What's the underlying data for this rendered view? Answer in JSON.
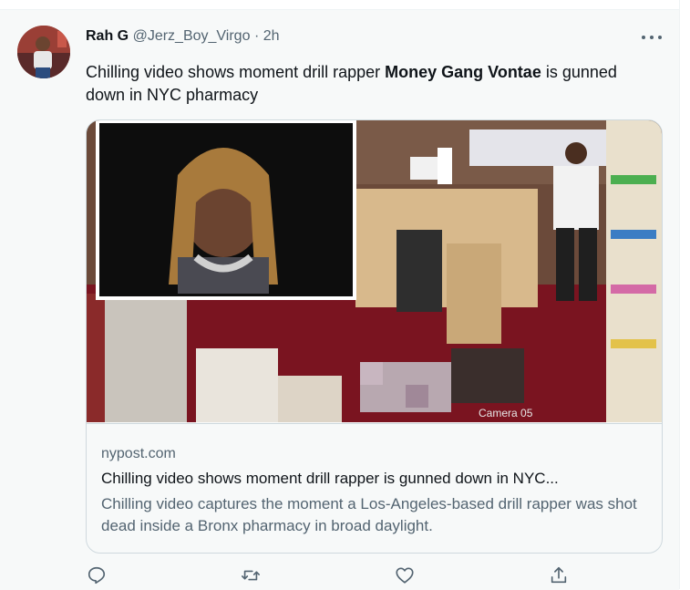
{
  "tweet": {
    "author_name": "Rah G",
    "author_handle": "@Jerz_Boy_Virgo",
    "separator": "·",
    "time": "2h",
    "text_before": "Chilling video shows moment drill rapper ",
    "text_bold": "Money Gang Vontae",
    "text_after": " is gunned down in NYC pharmacy"
  },
  "card": {
    "domain": "nypost.com",
    "title": "Chilling video shows moment drill rapper is gunned down in NYC...",
    "description": "Chilling video captures the moment a Los-Angeles-based drill rapper was shot dead inside a Bronx pharmacy in broad daylight.",
    "image_overlay_text": "Camera 05"
  },
  "icons": {
    "more": "more-dots-icon",
    "reply": "reply-icon",
    "retweet": "retweet-icon",
    "like": "heart-icon",
    "share": "share-icon"
  },
  "colors": {
    "text": "#0f1419",
    "secondary": "#536471",
    "border": "#cfd9de",
    "background": "#f7f9f9"
  }
}
